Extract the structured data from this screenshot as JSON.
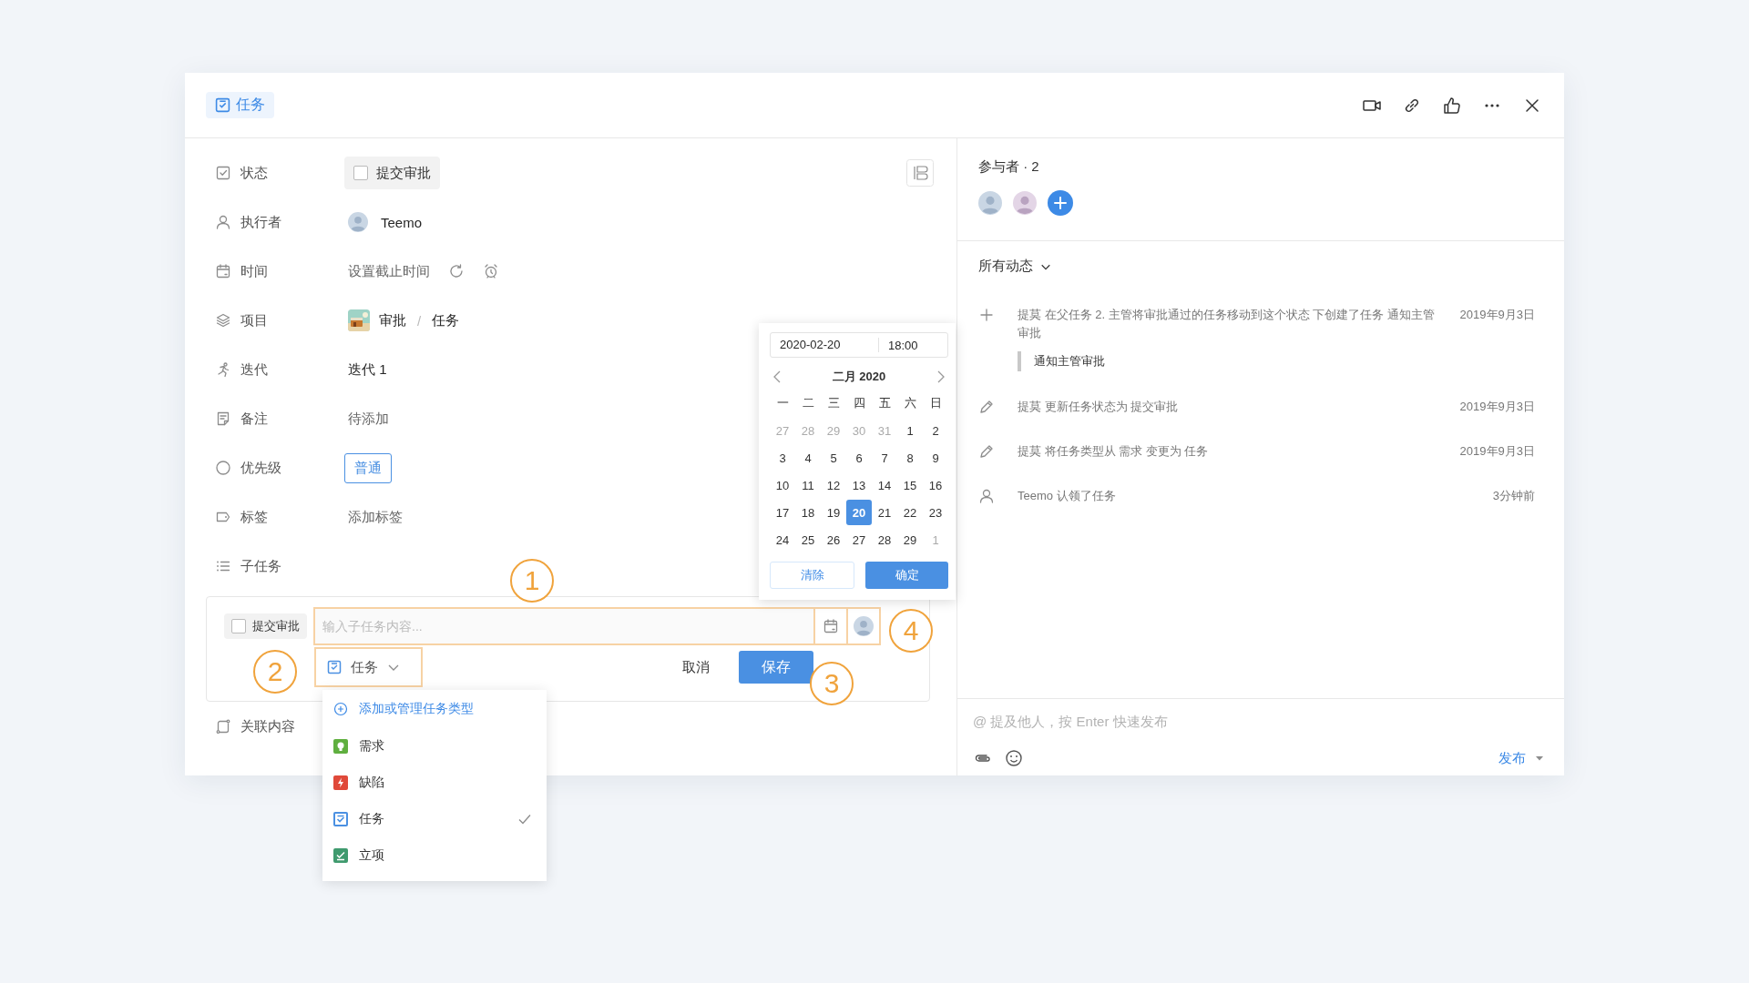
{
  "header": {
    "type_tag": "任务"
  },
  "fields": [
    {
      "kind": "status",
      "label": "状态",
      "value": "提交审批",
      "checked": false
    },
    {
      "kind": "assignee",
      "label": "执行者",
      "value": "Teemo"
    },
    {
      "kind": "time",
      "label": "时间",
      "value": "设置截止时间"
    },
    {
      "kind": "project",
      "label": "项目",
      "value": "审批",
      "separator": "/",
      "section": "任务"
    },
    {
      "kind": "text",
      "label": "迭代",
      "value": "迭代 1"
    },
    {
      "kind": "placeholder",
      "label": "备注",
      "value": "待添加"
    },
    {
      "kind": "tag",
      "label": "优先级",
      "value": "普通"
    },
    {
      "kind": "placeholder",
      "label": "标签",
      "value": "添加标签"
    },
    {
      "kind": "heading",
      "label": "子任务"
    }
  ],
  "subtask_editor": {
    "status": "提交审批",
    "checked": false,
    "placeholder": "输入子任务内容...",
    "type": "任务",
    "cancel": "取消",
    "save": "保存"
  },
  "related": {
    "label": "关联内容"
  },
  "date_picker": {
    "date": "2020-02-20",
    "time": "18:00",
    "month_title": "二月 2020",
    "weekdays": [
      "一",
      "二",
      "三",
      "四",
      "五",
      "六",
      "日"
    ],
    "weeks": [
      [
        {
          "day": "27",
          "outside": true,
          "selected": false
        },
        {
          "day": "28",
          "outside": true,
          "selected": false
        },
        {
          "day": "29",
          "outside": true,
          "selected": false
        },
        {
          "day": "30",
          "outside": true,
          "selected": false
        },
        {
          "day": "31",
          "outside": true,
          "selected": false
        },
        {
          "day": "1",
          "outside": false,
          "selected": false
        },
        {
          "day": "2",
          "outside": false,
          "selected": false
        }
      ],
      [
        {
          "day": "3",
          "outside": false,
          "selected": false
        },
        {
          "day": "4",
          "outside": false,
          "selected": false
        },
        {
          "day": "5",
          "outside": false,
          "selected": false
        },
        {
          "day": "6",
          "outside": false,
          "selected": false
        },
        {
          "day": "7",
          "outside": false,
          "selected": false
        },
        {
          "day": "8",
          "outside": false,
          "selected": false
        },
        {
          "day": "9",
          "outside": false,
          "selected": false
        }
      ],
      [
        {
          "day": "10",
          "outside": false,
          "selected": false
        },
        {
          "day": "11",
          "outside": false,
          "selected": false
        },
        {
          "day": "12",
          "outside": false,
          "selected": false
        },
        {
          "day": "13",
          "outside": false,
          "selected": false
        },
        {
          "day": "14",
          "outside": false,
          "selected": false
        },
        {
          "day": "15",
          "outside": false,
          "selected": false
        },
        {
          "day": "16",
          "outside": false,
          "selected": false
        }
      ],
      [
        {
          "day": "17",
          "outside": false,
          "selected": false
        },
        {
          "day": "18",
          "outside": false,
          "selected": false
        },
        {
          "day": "19",
          "outside": false,
          "selected": false
        },
        {
          "day": "20",
          "outside": false,
          "selected": true
        },
        {
          "day": "21",
          "outside": false,
          "selected": false
        },
        {
          "day": "22",
          "outside": false,
          "selected": false
        },
        {
          "day": "23",
          "outside": false,
          "selected": false
        }
      ],
      [
        {
          "day": "24",
          "outside": false,
          "selected": false
        },
        {
          "day": "25",
          "outside": false,
          "selected": false
        },
        {
          "day": "26",
          "outside": false,
          "selected": false
        },
        {
          "day": "27",
          "outside": false,
          "selected": false
        },
        {
          "day": "28",
          "outside": false,
          "selected": false
        },
        {
          "day": "29",
          "outside": false,
          "selected": false
        },
        {
          "day": "1",
          "outside": true,
          "selected": false
        }
      ]
    ],
    "clear": "清除",
    "confirm": "确定"
  },
  "type_menu": {
    "add": "添加或管理任务类型",
    "items": [
      {
        "kind": "bulb",
        "label": "需求",
        "color": "#5faf3f",
        "selected": false
      },
      {
        "kind": "bolt",
        "label": "缺陷",
        "color": "#e0493a",
        "selected": false
      },
      {
        "kind": "task",
        "label": "任务",
        "color": "#4a90e2",
        "selected": true
      },
      {
        "kind": "approve",
        "label": "立项",
        "color": "#3f9a6e",
        "selected": false
      }
    ]
  },
  "annotations": [
    "1",
    "2",
    "3",
    "4"
  ],
  "participants": {
    "title": "参与者 · 2"
  },
  "activity": {
    "filter": "所有动态",
    "items": [
      {
        "kind": "create",
        "text": "提莫 在父任务 2. 主管将审批通过的任务移动到这个状态 下创建了任务 通知主管审批",
        "quote": "通知主管审批",
        "time": "2019年9月3日"
      },
      {
        "kind": "edit",
        "text": "提莫 更新任务状态为 提交审批",
        "time": "2019年9月3日"
      },
      {
        "kind": "edit",
        "text": "提莫 将任务类型从 需求 变更为 任务",
        "time": "2019年9月3日"
      },
      {
        "kind": "claim",
        "text": "Teemo 认领了任务",
        "time": "3分钟前"
      }
    ]
  },
  "comment": {
    "placeholder": "@ 提及他人，按 Enter 快速发布",
    "publish": "发布"
  }
}
